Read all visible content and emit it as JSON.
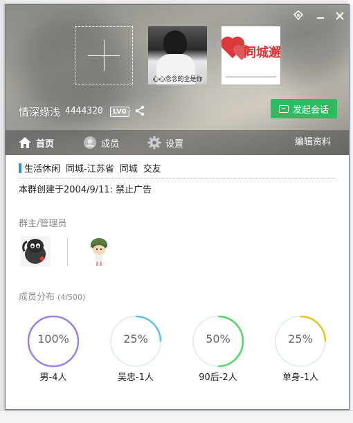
{
  "window": {
    "controls": [
      "skin",
      "minimize",
      "close"
    ]
  },
  "group": {
    "name": "情深缘浅",
    "id": "4444320",
    "level_badge": "LV0",
    "start_chat_label": "发起会话"
  },
  "photos": {
    "photo1_caption": "心心念念的全是你"
  },
  "tabs": {
    "home": "首页",
    "members": "成员",
    "settings": "设置",
    "edit": "编辑资料"
  },
  "tags": [
    "生活休闲",
    "同城-江苏省",
    "同城",
    "交友"
  ],
  "created_text": "本群创建于2004/9/11: 禁止广告",
  "admins_title": "群主/管理员",
  "distribution": {
    "title": "成员分布",
    "count": "(4/500)",
    "stats": [
      {
        "percent_label": "100%",
        "label": "男-4人",
        "value": 1.0,
        "color": "#9b7fe6"
      },
      {
        "percent_label": "25%",
        "label": "吴忠-1人",
        "value": 0.25,
        "color": "#5bc0eb"
      },
      {
        "percent_label": "50%",
        "label": "90后-2人",
        "value": 0.5,
        "color": "#4cd964"
      },
      {
        "percent_label": "25%",
        "label": "单身-1人",
        "value": 0.25,
        "color": "#e8c21a"
      }
    ]
  },
  "colors": {
    "accent_green": "#2ebc63",
    "tag_bar": "#2d8cf0"
  }
}
